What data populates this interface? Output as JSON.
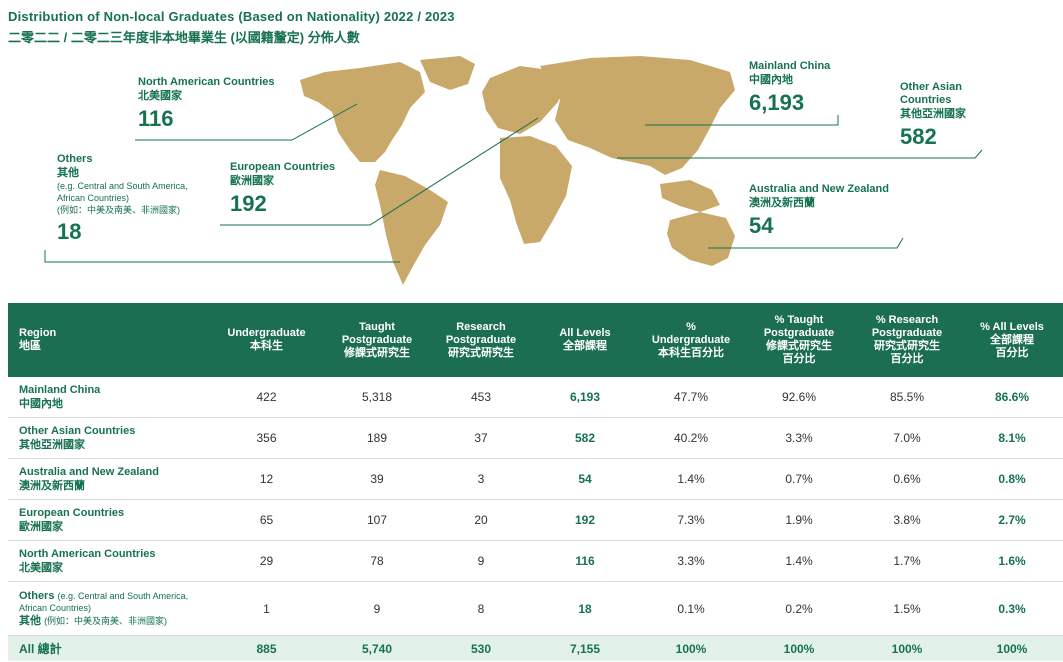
{
  "title": "Distribution of Non-local Graduates (Based on Nationality) 2022 / 2023",
  "subtitle": "二零二二 / 二零二三年度非本地畢業生 (以國籍釐定) 分佈人數",
  "colors": {
    "brand_green": "#1b6e52",
    "map_gold": "#c9a96a",
    "total_row_bg": "#e3f2e9"
  },
  "callouts": {
    "north_america": {
      "en": "North American Countries",
      "zh": "北美國家",
      "value": "116"
    },
    "others": {
      "en": "Others",
      "zh": "其他",
      "note_en_1": "(e.g. Central and South America,",
      "note_en_2": "African Countries)",
      "note_zh": "(例如：中美及南美、非洲國家)",
      "value": "18"
    },
    "europe": {
      "en": "European Countries",
      "zh": "歐洲國家",
      "value": "192"
    },
    "mainland": {
      "en": "Mainland China",
      "zh": "中國內地",
      "value": "6,193"
    },
    "other_asian": {
      "en_1": "Other Asian",
      "en_2": "Countries",
      "zh": "其他亞洲國家",
      "value": "582"
    },
    "australia": {
      "en": "Australia and New Zealand",
      "zh": "澳洲及新西蘭",
      "value": "54"
    }
  },
  "table": {
    "headers": [
      {
        "en": "Region",
        "zh": "地區"
      },
      {
        "en": "Undergraduate",
        "zh": "本科生"
      },
      {
        "en_1": "Taught",
        "en_2": "Postgraduate",
        "zh": "修課式研究生"
      },
      {
        "en_1": "Research",
        "en_2": "Postgraduate",
        "zh": "研究式研究生"
      },
      {
        "en": "All Levels",
        "zh": "全部課程"
      },
      {
        "en_1": "%",
        "en_2": "Undergraduate",
        "zh": "本科生百分比"
      },
      {
        "en_1": "% Taught",
        "en_2": "Postgraduate",
        "zh_1": "修課式研究生",
        "zh_2": "百分比"
      },
      {
        "en_1": "% Research",
        "en_2": "Postgraduate",
        "zh_1": "研究式研究生",
        "zh_2": "百分比"
      },
      {
        "en": "% All Levels",
        "zh_1": "全部課程",
        "zh_2": "百分比"
      }
    ],
    "rows": [
      {
        "en": "Mainland China",
        "zh": "中國內地",
        "ug": "422",
        "tpg": "5,318",
        "rpg": "453",
        "all": "6,193",
        "p_ug": "47.7%",
        "p_tpg": "92.6%",
        "p_rpg": "85.5%",
        "p_all": "86.6%"
      },
      {
        "en": "Other Asian Countries",
        "zh": "其他亞洲國家",
        "ug": "356",
        "tpg": "189",
        "rpg": "37",
        "all": "582",
        "p_ug": "40.2%",
        "p_tpg": "3.3%",
        "p_rpg": "7.0%",
        "p_all": "8.1%"
      },
      {
        "en": "Australia and New Zealand",
        "zh": "澳洲及新西蘭",
        "ug": "12",
        "tpg": "39",
        "rpg": "3",
        "all": "54",
        "p_ug": "1.4%",
        "p_tpg": "0.7%",
        "p_rpg": "0.6%",
        "p_all": "0.8%"
      },
      {
        "en": "European Countries",
        "zh": "歐洲國家",
        "ug": "65",
        "tpg": "107",
        "rpg": "20",
        "all": "192",
        "p_ug": "7.3%",
        "p_tpg": "1.9%",
        "p_rpg": "3.8%",
        "p_all": "2.7%"
      },
      {
        "en": "North American Countries",
        "zh": "北美國家",
        "ug": "29",
        "tpg": "78",
        "rpg": "9",
        "all": "116",
        "p_ug": "3.3%",
        "p_tpg": "1.4%",
        "p_rpg": "1.7%",
        "p_all": "1.6%"
      }
    ],
    "others_row": {
      "en": "Others",
      "note_en_1": "(e.g. Central and South America,",
      "note_en_2": "African Countries)",
      "zh": "其他",
      "note_zh": "(例如：中美及南美、非洲國家)",
      "ug": "1",
      "tpg": "9",
      "rpg": "8",
      "all": "18",
      "p_ug": "0.1%",
      "p_tpg": "0.2%",
      "p_rpg": "1.5%",
      "p_all": "0.3%"
    },
    "total_row": {
      "label": "All 總計",
      "ug": "885",
      "tpg": "5,740",
      "rpg": "530",
      "all": "7,155",
      "p_ug": "100%",
      "p_tpg": "100%",
      "p_rpg": "100%",
      "p_all": "100%"
    }
  }
}
